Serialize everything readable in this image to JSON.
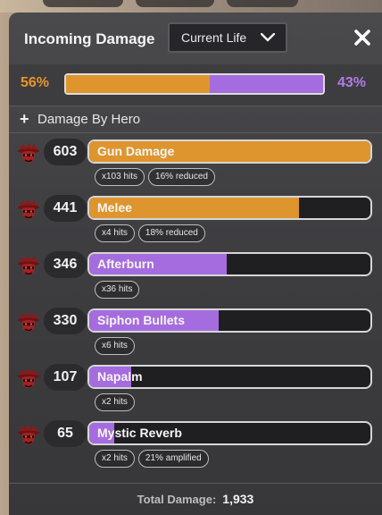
{
  "header": {
    "title": "Incoming Damage",
    "dropdown_value": "Current Life",
    "close_icon": "close-icon"
  },
  "ratio": {
    "left_pct": "56%",
    "right_pct": "43%",
    "left_fraction": 0.56,
    "left_color": "#de952e",
    "right_color": "#a56cdf"
  },
  "section": {
    "plus": "+",
    "label": "Damage By Hero"
  },
  "rows": [
    {
      "amount": "603",
      "name": "Gun Damage",
      "fill": 1.0,
      "color": "#de952e",
      "tags": [
        "x103 hits",
        "16% reduced"
      ]
    },
    {
      "amount": "441",
      "name": "Melee",
      "fill": 0.745,
      "color": "#de952e",
      "tags": [
        "x4 hits",
        "18% reduced"
      ]
    },
    {
      "amount": "346",
      "name": "Afterburn",
      "fill": 0.49,
      "color": "#a56cdf",
      "tags": [
        "x36 hits"
      ]
    },
    {
      "amount": "330",
      "name": "Siphon Bullets",
      "fill": 0.46,
      "color": "#a56cdf",
      "tags": [
        "x6 hits"
      ]
    },
    {
      "amount": "107",
      "name": "Napalm",
      "fill": 0.15,
      "color": "#a56cdf",
      "tags": [
        "x2 hits"
      ]
    },
    {
      "amount": "65",
      "name": "Mystic Reverb",
      "fill": 0.09,
      "color": "#a56cdf",
      "tags": [
        "x2 hits",
        "21% amplified"
      ]
    }
  ],
  "footer": {
    "label": "Total Damage:",
    "value": "1,933"
  }
}
